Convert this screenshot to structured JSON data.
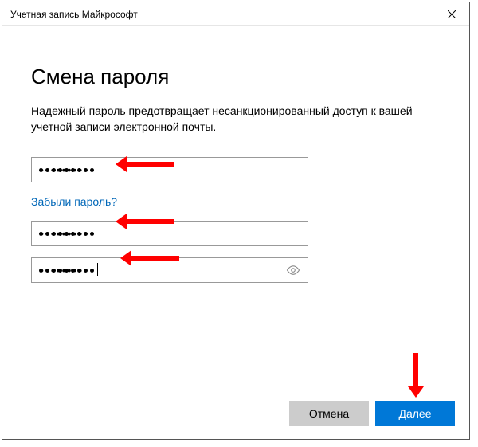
{
  "window": {
    "title": "Учетная запись Майкрософт",
    "close_icon": "✕"
  },
  "heading": "Смена пароля",
  "description": "Надежный пароль предотвращает несанкционированный доступ к вашей учетной записи электронной почты.",
  "fields": {
    "current": {
      "value": "●●●●●●●●●",
      "dot_count": 9
    },
    "new": {
      "value": "●●●●●●●●●",
      "dot_count": 9
    },
    "confirm": {
      "value": "●●●●●●●●●",
      "dot_count": 9,
      "show_eye": true,
      "has_caret": true
    }
  },
  "forgot_link": "Забыли пароль?",
  "buttons": {
    "cancel": "Отмена",
    "next": "Далее"
  },
  "icons": {
    "eye": "◉"
  }
}
